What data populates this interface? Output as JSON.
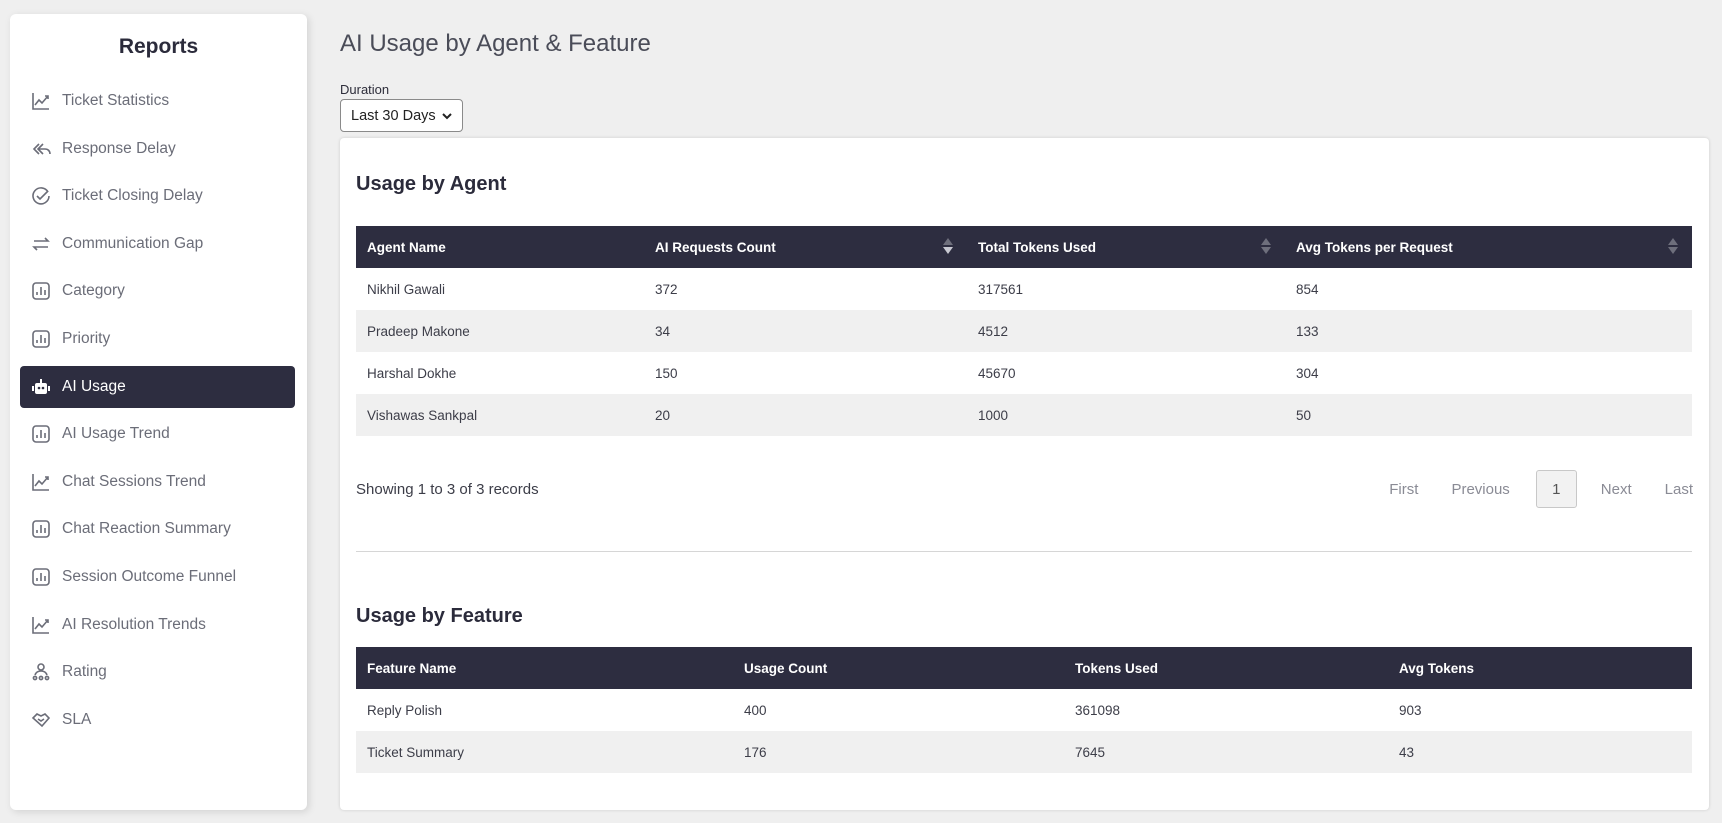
{
  "sidebar": {
    "title": "Reports",
    "items": [
      {
        "label": "Ticket Statistics",
        "icon": "trend-line-icon"
      },
      {
        "label": "Response Delay",
        "icon": "reply-all-icon"
      },
      {
        "label": "Ticket Closing Delay",
        "icon": "check-circle-icon"
      },
      {
        "label": "Communication Gap",
        "icon": "swap-arrows-icon"
      },
      {
        "label": "Category",
        "icon": "bar-chart-icon"
      },
      {
        "label": "Priority",
        "icon": "bar-chart-icon"
      },
      {
        "label": "AI Usage",
        "icon": "robot-icon",
        "active": true
      },
      {
        "label": "AI Usage Trend",
        "icon": "bar-chart-icon"
      },
      {
        "label": "Chat Sessions Trend",
        "icon": "trend-line-icon"
      },
      {
        "label": "Chat Reaction Summary",
        "icon": "bar-chart-icon"
      },
      {
        "label": "Session Outcome Funnel",
        "icon": "bar-chart-icon"
      },
      {
        "label": "AI Resolution Trends",
        "icon": "trend-line-icon"
      },
      {
        "label": "Rating",
        "icon": "user-network-icon"
      },
      {
        "label": "SLA",
        "icon": "handshake-icon"
      }
    ]
  },
  "main": {
    "title": "AI Usage by Agent & Feature",
    "duration": {
      "label": "Duration",
      "value": "Last 30 Days"
    }
  },
  "agent_section": {
    "title": "Usage by Agent",
    "columns": [
      "Agent Name",
      "AI Requests Count",
      "Total Tokens Used",
      "Avg Tokens per Request"
    ],
    "rows": [
      [
        "Nikhil Gawali",
        "372",
        "317561",
        "854"
      ],
      [
        "Pradeep Makone",
        "34",
        "4512",
        "133"
      ],
      [
        "Harshal Dokhe",
        "150",
        "45670",
        "304"
      ],
      [
        "Vishawas Sankpal",
        "20",
        "1000",
        "50"
      ]
    ],
    "showing": "Showing 1 to 3 of 3 records",
    "pager": {
      "first": "First",
      "previous": "Previous",
      "page": "1",
      "next": "Next",
      "last": "Last"
    }
  },
  "feature_section": {
    "title": "Usage by Feature",
    "columns": [
      "Feature Name",
      "Usage Count",
      "Tokens Used",
      "Avg Tokens"
    ],
    "rows": [
      [
        "Reply Polish",
        "400",
        "361098",
        "903"
      ],
      [
        "Ticket Summary",
        "176",
        "7645",
        "43"
      ]
    ]
  },
  "colors": {
    "header_bg": "#2d2d40",
    "active_item_bg": "#2d2d40",
    "page_bg": "#efefef"
  }
}
